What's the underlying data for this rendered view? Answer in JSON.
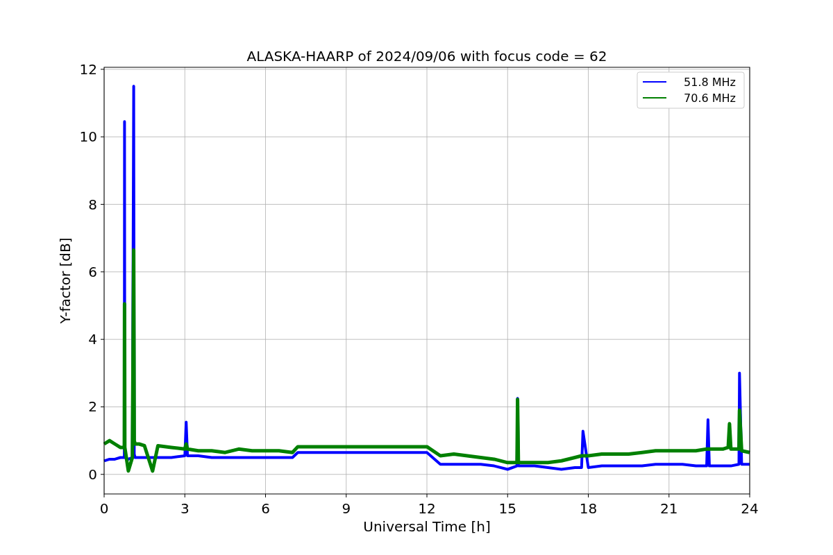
{
  "chart_data": {
    "type": "line",
    "title": "ALASKA-HAARP of 2024/09/06 with focus code = 62",
    "xlabel": "Universal Time [h]",
    "ylabel": "Y-factor [dB]",
    "x": [
      0,
      0.2,
      0.4,
      0.6,
      0.75,
      0.76,
      0.77,
      0.9,
      1.05,
      1.1,
      1.12,
      1.15,
      1.3,
      1.5,
      1.8,
      2.0,
      2.5,
      3.0,
      3.05,
      3.1,
      3.5,
      4,
      4.5,
      5,
      5.5,
      6,
      6.5,
      7,
      7.2,
      12,
      12.5,
      13,
      13.5,
      14,
      14.5,
      15,
      15.35,
      15.37,
      15.4,
      16,
      16.5,
      17,
      17.5,
      17.75,
      17.8,
      18,
      18.5,
      19,
      19.5,
      20,
      20.5,
      21,
      21.5,
      22,
      22.4,
      22.45,
      22.5,
      23,
      23.2,
      23.25,
      23.3,
      23.6,
      23.62,
      23.7,
      24
    ],
    "series": [
      {
        "name": "51.8 MHz",
        "color": "#0000ff",
        "values": [
          0.4,
          0.45,
          0.45,
          0.5,
          0.5,
          10.45,
          0.5,
          0.45,
          0.5,
          11.5,
          0.6,
          0.5,
          0.5,
          0.5,
          0.5,
          0.5,
          0.5,
          0.55,
          1.55,
          0.55,
          0.55,
          0.5,
          0.5,
          0.5,
          0.5,
          0.5,
          0.5,
          0.5,
          0.65,
          0.65,
          0.3,
          0.3,
          0.3,
          0.3,
          0.25,
          0.15,
          0.25,
          2.25,
          0.25,
          0.25,
          0.2,
          0.15,
          0.2,
          0.2,
          1.28,
          0.2,
          0.25,
          0.25,
          0.25,
          0.25,
          0.3,
          0.3,
          0.3,
          0.25,
          0.25,
          1.62,
          0.25,
          0.25,
          0.25,
          0.25,
          0.25,
          0.3,
          3.0,
          0.3,
          0.3
        ]
      },
      {
        "name": "70.6 MHz",
        "color": "#008000",
        "values": [
          0.9,
          1.0,
          0.9,
          0.8,
          0.8,
          5.05,
          0.8,
          0.1,
          0.5,
          6.65,
          1.0,
          0.9,
          0.9,
          0.85,
          0.1,
          0.85,
          0.8,
          0.75,
          0.9,
          0.75,
          0.7,
          0.7,
          0.65,
          0.75,
          0.7,
          0.7,
          0.7,
          0.65,
          0.82,
          0.82,
          0.55,
          0.6,
          0.55,
          0.5,
          0.45,
          0.35,
          0.35,
          2.22,
          0.35,
          0.35,
          0.35,
          0.4,
          0.5,
          0.55,
          0.55,
          0.55,
          0.6,
          0.6,
          0.6,
          0.65,
          0.7,
          0.7,
          0.7,
          0.7,
          0.75,
          0.75,
          0.75,
          0.75,
          0.8,
          1.5,
          0.75,
          0.75,
          1.9,
          0.7,
          0.65
        ]
      }
    ],
    "xlim": [
      0,
      24
    ],
    "ylim": [
      -0.58,
      12.06
    ],
    "xticks": [
      0,
      3,
      6,
      9,
      12,
      15,
      18,
      21,
      24
    ],
    "yticks": [
      0,
      2,
      4,
      6,
      8,
      10,
      12
    ],
    "grid": true,
    "legend": true
  }
}
